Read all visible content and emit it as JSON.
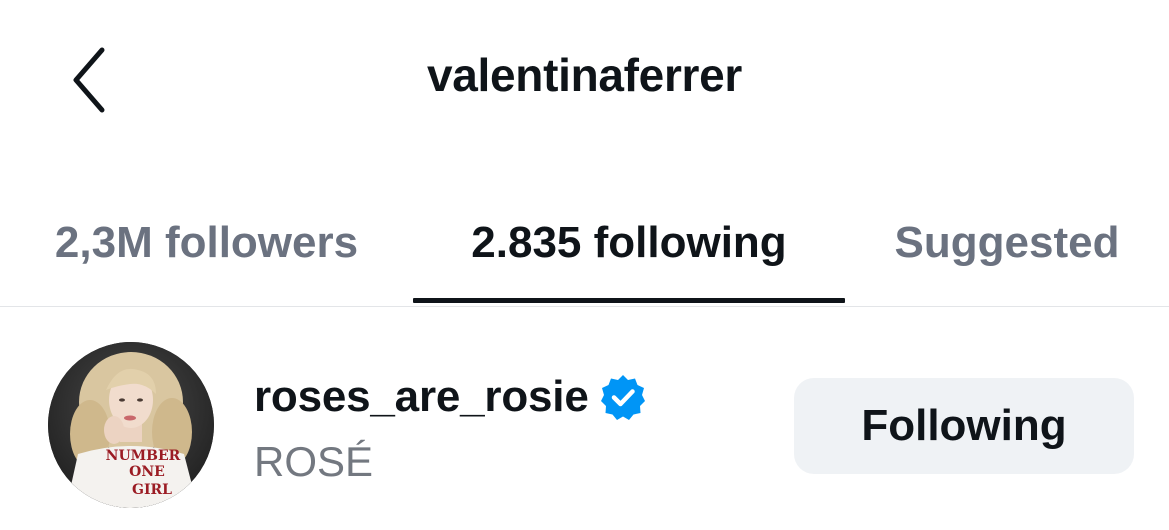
{
  "header": {
    "title": "valentinaferrer",
    "back_icon": "chevron-left-icon"
  },
  "tabs": [
    {
      "label": "2,3M followers",
      "active": false
    },
    {
      "label": "2.835 following",
      "active": true
    },
    {
      "label": "Suggested",
      "active": false
    }
  ],
  "user_row": {
    "username": "roses_are_rosie",
    "verified": true,
    "display_name": "ROSÉ",
    "shirt_text": [
      "NUMBER",
      "ONE",
      "GIRL"
    ],
    "button_label": "Following"
  },
  "colors": {
    "text_primary": "#0f1419",
    "text_secondary": "#6b7280",
    "verified_blue": "#0095f6",
    "button_bg": "#eff2f5",
    "divider": "#e3e5e8"
  }
}
